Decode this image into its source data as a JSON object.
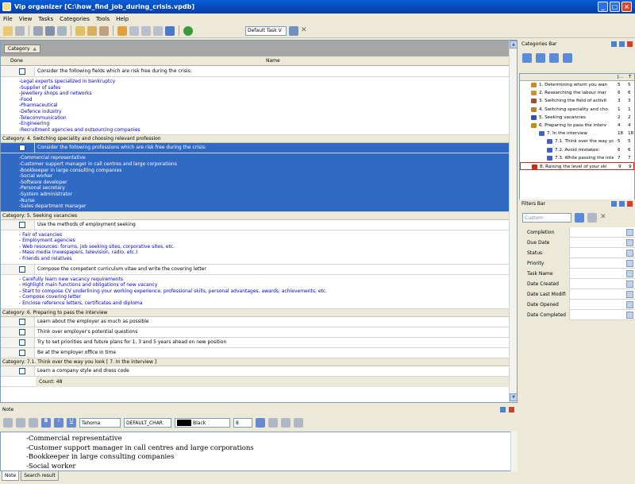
{
  "window": {
    "title": "Vip organizer [C:\\how_find_job_during_crisis.vpdb]"
  },
  "menu": [
    "File",
    "View",
    "Tasks",
    "Categories",
    "Tools",
    "Help"
  ],
  "toolbar": {
    "view_select": "Default Task V"
  },
  "grid": {
    "group_chip": "Category",
    "col_done": "Done",
    "col_name": "Name",
    "rows": [
      {
        "kind": "task",
        "text": "Consider the following fields which are risk free during the crisis:"
      },
      {
        "kind": "notes",
        "lines": [
          "-Legal experts specialized in bankruptcy",
          "-Supplier of safes",
          "-Jewellery shops and networks",
          "-Food",
          "-Pharmaceutical",
          "-Defence industry",
          "-Telecommunication",
          "-Engineering",
          "-Recruitment agencies and outsourcing companies"
        ]
      },
      {
        "kind": "cat",
        "text": "Category: 4. Switching speciality and choosing relevant profession"
      },
      {
        "kind": "task",
        "selected": true,
        "text": "Consider the following professions which are risk free during the crisis:"
      },
      {
        "kind": "notes",
        "selected": true,
        "lines": [
          "-Commercial representative",
          "-Customer support manager in call centres and large corporations",
          "-Bookkeeper in large consulting companies",
          "-Social worker",
          "-Software developer",
          "-Personal secretary",
          "-System administrator",
          "-Nurse",
          "-Sales department manager"
        ]
      },
      {
        "kind": "cat",
        "text": "Category: 5. Seeking vacancies"
      },
      {
        "kind": "task",
        "text": "Use the methods of employment seeking"
      },
      {
        "kind": "notes",
        "lines": [
          "- Fair of vacancies",
          "- Employment agencies",
          "- Web resources: forums, job seeking sites, corporative sites, etc.",
          "- Mass media (newspapers, television, radio, etc.)",
          "- Friends and relatives"
        ]
      },
      {
        "kind": "task",
        "text": "Compose the competent curriculum vitae and write the covering letter"
      },
      {
        "kind": "notes",
        "lines": [
          "- Carefully learn new vacancy requirements",
          "- Highlight main functions and obligations of new vacancy",
          "- Start to compose CV underlining your working experience, professional skills, personal advantages, awards, achievements, etc.",
          "- Compose covering letter",
          "- Enclose reference letters, certificates and diploma"
        ]
      },
      {
        "kind": "cat",
        "text": "Category: 6. Preparing to pass the interview"
      },
      {
        "kind": "task",
        "text": "Learn about the employer as much as possible"
      },
      {
        "kind": "task",
        "text": "Think over employer's potential questions"
      },
      {
        "kind": "task",
        "text": "Try to set priorities and future plans for 1, 3 and 5 years ahead on new position"
      },
      {
        "kind": "task",
        "text": "Be at the employer office in time"
      },
      {
        "kind": "cat",
        "text": "Category: 7.1. Think over the way you look   [ 7. In the interview ]"
      },
      {
        "kind": "task",
        "text": "Learn a company style and dress code"
      }
    ],
    "count": "Count: 48"
  },
  "note": {
    "title": "Note",
    "font": "Tahoma",
    "charset": "DEFAULT_CHAR",
    "color": "Black",
    "size": "8",
    "lines": [
      "-Commercial representative",
      "-Customer support manager in call centres and large corporations",
      "-Bookkeeper in large consulting companies",
      "-Social worker"
    ],
    "tabs": [
      "Note",
      "Search result"
    ]
  },
  "categories_bar": {
    "title": "Categories Bar",
    "col_j": "J...",
    "col_t": "T",
    "items": [
      {
        "label": "1. Determining whom you wan",
        "n1": "5",
        "n2": "5",
        "indent": 0,
        "color": "#d08a20"
      },
      {
        "label": "2. Researching the labour mar",
        "n1": "6",
        "n2": "6",
        "indent": 0,
        "color": "#d09030"
      },
      {
        "label": "3. Switching the field of activit",
        "n1": "3",
        "n2": "3",
        "indent": 0,
        "color": "#a05030"
      },
      {
        "label": "4. Switching speciality and cho",
        "n1": "1",
        "n2": "1",
        "indent": 0,
        "color": "#c08020"
      },
      {
        "label": "5. Seeking vacancies",
        "n1": "2",
        "n2": "2",
        "indent": 0,
        "color": "#3050c0"
      },
      {
        "label": "6. Preparing to pass the interv",
        "n1": "4",
        "n2": "4",
        "indent": 0,
        "color": "#c09000"
      },
      {
        "label": "7. In the interview",
        "n1": "18",
        "n2": "18",
        "indent": 1,
        "color": "#4060d0"
      },
      {
        "label": "7.1. Think over the way yc",
        "n1": "5",
        "n2": "5",
        "indent": 2,
        "color": "#4060d0"
      },
      {
        "label": "7.2. Avoid mistakes:",
        "n1": "6",
        "n2": "6",
        "indent": 2,
        "color": "#4060d0"
      },
      {
        "label": "7.3. While passing the inte",
        "n1": "7",
        "n2": "7",
        "indent": 2,
        "color": "#4060d0"
      },
      {
        "label": "8. Raising the level of your ski",
        "n1": "9",
        "n2": "9",
        "indent": 0,
        "color": "#c03020"
      }
    ]
  },
  "filters_bar": {
    "title": "Filters Bar",
    "preset": "Custom",
    "items": [
      "Completion",
      "Due Date",
      "Status",
      "Priority",
      "Task Name",
      "Date Created",
      "Date Last Modifi",
      "Date Opened",
      "Date Completed"
    ]
  }
}
